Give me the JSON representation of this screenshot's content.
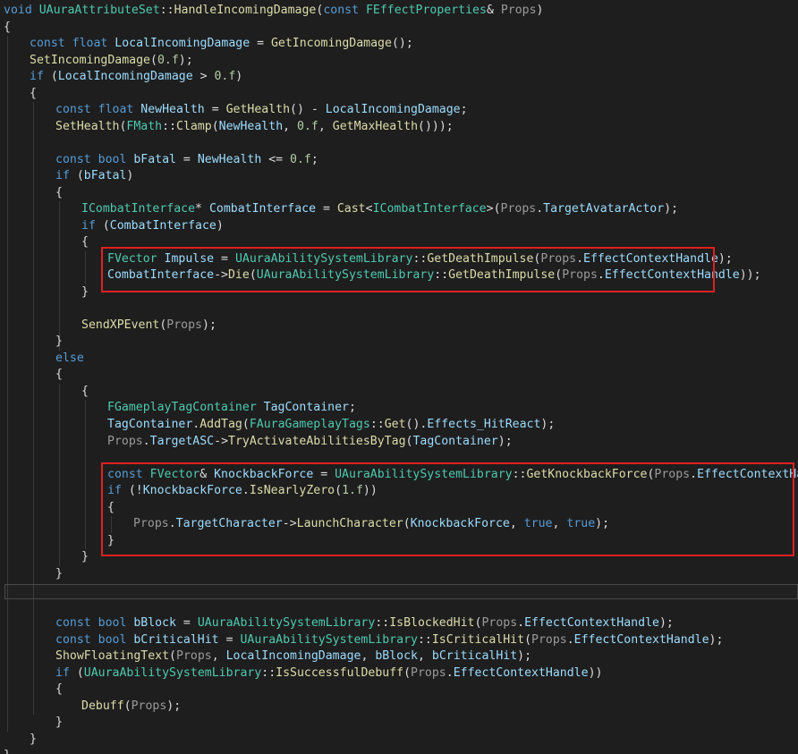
{
  "palette": {
    "background": "#1e1e1e",
    "keyword": "#569cd6",
    "type": "#4ec9b0",
    "function": "#dcdcaa",
    "variable": "#9cdcfe",
    "parameter": "#9a9a9a",
    "number": "#b5cea8",
    "plain": "#dcdcdc",
    "highlight_box": "#e02020"
  },
  "lines": [
    [
      {
        "t": "void ",
        "c": "kw"
      },
      {
        "t": "UAuraAttributeSet",
        "c": "ty"
      },
      {
        "t": "::",
        "c": "pl"
      },
      {
        "t": "HandleIncomingDamage",
        "c": "fn"
      },
      {
        "t": "(",
        "c": "pl"
      },
      {
        "t": "const ",
        "c": "kw"
      },
      {
        "t": "FEffectProperties",
        "c": "ty"
      },
      {
        "t": "& ",
        "c": "pl"
      },
      {
        "t": "Props",
        "c": "par"
      },
      {
        "t": ")",
        "c": "pl"
      }
    ],
    [
      {
        "t": "{",
        "c": "pl"
      }
    ],
    [
      {
        "t": "const ",
        "c": "kw"
      },
      {
        "t": "float ",
        "c": "kw"
      },
      {
        "t": "LocalIncomingDamage",
        "c": "var"
      },
      {
        "t": " = ",
        "c": "pl"
      },
      {
        "t": "GetIncomingDamage",
        "c": "fn"
      },
      {
        "t": "();",
        "c": "pl"
      }
    ],
    [
      {
        "t": "SetIncomingDamage",
        "c": "fn"
      },
      {
        "t": "(",
        "c": "pl"
      },
      {
        "t": "0.f",
        "c": "num"
      },
      {
        "t": ");",
        "c": "pl"
      }
    ],
    [
      {
        "t": "if ",
        "c": "kw"
      },
      {
        "t": "(",
        "c": "pl"
      },
      {
        "t": "LocalIncomingDamage",
        "c": "var"
      },
      {
        "t": " > ",
        "c": "pl"
      },
      {
        "t": "0.f",
        "c": "num"
      },
      {
        "t": ")",
        "c": "pl"
      }
    ],
    [
      {
        "t": "{",
        "c": "pl"
      }
    ],
    [
      {
        "t": "const ",
        "c": "kw"
      },
      {
        "t": "float ",
        "c": "kw"
      },
      {
        "t": "NewHealth",
        "c": "var"
      },
      {
        "t": " = ",
        "c": "pl"
      },
      {
        "t": "GetHealth",
        "c": "fn"
      },
      {
        "t": "() - ",
        "c": "pl"
      },
      {
        "t": "LocalIncomingDamage",
        "c": "var"
      },
      {
        "t": ";",
        "c": "pl"
      }
    ],
    [
      {
        "t": "SetHealth",
        "c": "fn"
      },
      {
        "t": "(",
        "c": "pl"
      },
      {
        "t": "FMath",
        "c": "ty"
      },
      {
        "t": "::",
        "c": "pl"
      },
      {
        "t": "Clamp",
        "c": "fn"
      },
      {
        "t": "(",
        "c": "pl"
      },
      {
        "t": "NewHealth",
        "c": "var"
      },
      {
        "t": ", ",
        "c": "pl"
      },
      {
        "t": "0.f",
        "c": "num"
      },
      {
        "t": ", ",
        "c": "pl"
      },
      {
        "t": "GetMaxHealth",
        "c": "fn"
      },
      {
        "t": "()));",
        "c": "pl"
      }
    ],
    [],
    [
      {
        "t": "const ",
        "c": "kw"
      },
      {
        "t": "bool ",
        "c": "kw"
      },
      {
        "t": "bFatal",
        "c": "var"
      },
      {
        "t": " = ",
        "c": "pl"
      },
      {
        "t": "NewHealth",
        "c": "var"
      },
      {
        "t": " <= ",
        "c": "pl"
      },
      {
        "t": "0.f",
        "c": "num"
      },
      {
        "t": ";",
        "c": "pl"
      }
    ],
    [
      {
        "t": "if ",
        "c": "kw"
      },
      {
        "t": "(",
        "c": "pl"
      },
      {
        "t": "bFatal",
        "c": "var"
      },
      {
        "t": ")",
        "c": "pl"
      }
    ],
    [
      {
        "t": "{",
        "c": "pl"
      }
    ],
    [
      {
        "t": "ICombatInterface",
        "c": "ty"
      },
      {
        "t": "* ",
        "c": "pl"
      },
      {
        "t": "CombatInterface",
        "c": "var"
      },
      {
        "t": " = ",
        "c": "pl"
      },
      {
        "t": "Cast",
        "c": "fn"
      },
      {
        "t": "<",
        "c": "pl"
      },
      {
        "t": "ICombatInterface",
        "c": "ty"
      },
      {
        "t": ">(",
        "c": "pl"
      },
      {
        "t": "Props",
        "c": "par"
      },
      {
        "t": ".",
        "c": "pl"
      },
      {
        "t": "TargetAvatarActor",
        "c": "var"
      },
      {
        "t": ");",
        "c": "pl"
      }
    ],
    [
      {
        "t": "if ",
        "c": "kw"
      },
      {
        "t": "(",
        "c": "pl"
      },
      {
        "t": "CombatInterface",
        "c": "var"
      },
      {
        "t": ")",
        "c": "pl"
      }
    ],
    [
      {
        "t": "{",
        "c": "pl"
      }
    ],
    [
      {
        "t": "FVector ",
        "c": "ty"
      },
      {
        "t": "Impulse",
        "c": "var"
      },
      {
        "t": " = ",
        "c": "pl"
      },
      {
        "t": "UAuraAbilitySystemLibrary",
        "c": "ty"
      },
      {
        "t": "::",
        "c": "pl"
      },
      {
        "t": "GetDeathImpulse",
        "c": "fn"
      },
      {
        "t": "(",
        "c": "pl"
      },
      {
        "t": "Props",
        "c": "par"
      },
      {
        "t": ".",
        "c": "pl"
      },
      {
        "t": "EffectContextHandle",
        "c": "var"
      },
      {
        "t": ");",
        "c": "pl"
      }
    ],
    [
      {
        "t": "CombatInterface",
        "c": "var"
      },
      {
        "t": "->",
        "c": "pl"
      },
      {
        "t": "Die",
        "c": "fn"
      },
      {
        "t": "(",
        "c": "pl"
      },
      {
        "t": "UAuraAbilitySystemLibrary",
        "c": "ty"
      },
      {
        "t": "::",
        "c": "pl"
      },
      {
        "t": "GetDeathImpulse",
        "c": "fn"
      },
      {
        "t": "(",
        "c": "pl"
      },
      {
        "t": "Props",
        "c": "par"
      },
      {
        "t": ".",
        "c": "pl"
      },
      {
        "t": "EffectContextHandle",
        "c": "var"
      },
      {
        "t": "));",
        "c": "pl"
      }
    ],
    [
      {
        "t": "}",
        "c": "pl"
      }
    ],
    [],
    [
      {
        "t": "SendXPEvent",
        "c": "fn"
      },
      {
        "t": "(",
        "c": "pl"
      },
      {
        "t": "Props",
        "c": "par"
      },
      {
        "t": ");",
        "c": "pl"
      }
    ],
    [
      {
        "t": "}",
        "c": "pl"
      }
    ],
    [
      {
        "t": "else",
        "c": "kw"
      }
    ],
    [
      {
        "t": "{",
        "c": "pl"
      }
    ],
    [
      {
        "t": "{",
        "c": "pl"
      }
    ],
    [
      {
        "t": "FGameplayTagContainer ",
        "c": "ty"
      },
      {
        "t": "TagContainer",
        "c": "var"
      },
      {
        "t": ";",
        "c": "pl"
      }
    ],
    [
      {
        "t": "TagContainer",
        "c": "var"
      },
      {
        "t": ".",
        "c": "pl"
      },
      {
        "t": "AddTag",
        "c": "fn"
      },
      {
        "t": "(",
        "c": "pl"
      },
      {
        "t": "FAuraGameplayTags",
        "c": "ty"
      },
      {
        "t": "::",
        "c": "pl"
      },
      {
        "t": "Get",
        "c": "fn"
      },
      {
        "t": "().",
        "c": "pl"
      },
      {
        "t": "Effects_HitReact",
        "c": "var"
      },
      {
        "t": ");",
        "c": "pl"
      }
    ],
    [
      {
        "t": "Props",
        "c": "par"
      },
      {
        "t": ".",
        "c": "pl"
      },
      {
        "t": "TargetASC",
        "c": "var"
      },
      {
        "t": "->",
        "c": "pl"
      },
      {
        "t": "TryActivateAbilitiesByTag",
        "c": "fn"
      },
      {
        "t": "(",
        "c": "pl"
      },
      {
        "t": "TagContainer",
        "c": "var"
      },
      {
        "t": ");",
        "c": "pl"
      }
    ],
    [],
    [
      {
        "t": "const ",
        "c": "kw"
      },
      {
        "t": "FVector",
        "c": "ty"
      },
      {
        "t": "& ",
        "c": "pl"
      },
      {
        "t": "KnockbackForce",
        "c": "var"
      },
      {
        "t": " = ",
        "c": "pl"
      },
      {
        "t": "UAuraAbilitySystemLibrary",
        "c": "ty"
      },
      {
        "t": "::",
        "c": "pl"
      },
      {
        "t": "GetKnockbackForce",
        "c": "fn"
      },
      {
        "t": "(",
        "c": "pl"
      },
      {
        "t": "Props",
        "c": "par"
      },
      {
        "t": ".",
        "c": "pl"
      },
      {
        "t": "EffectContextHandle",
        "c": "var"
      },
      {
        "t": ");",
        "c": "pl"
      }
    ],
    [
      {
        "t": "if ",
        "c": "kw"
      },
      {
        "t": "(!",
        "c": "pl"
      },
      {
        "t": "KnockbackForce",
        "c": "var"
      },
      {
        "t": ".",
        "c": "pl"
      },
      {
        "t": "IsNearlyZero",
        "c": "fn"
      },
      {
        "t": "(",
        "c": "pl"
      },
      {
        "t": "1.f",
        "c": "num"
      },
      {
        "t": "))",
        "c": "pl"
      }
    ],
    [
      {
        "t": "{",
        "c": "pl"
      }
    ],
    [
      {
        "t": "Props",
        "c": "par"
      },
      {
        "t": ".",
        "c": "pl"
      },
      {
        "t": "TargetCharacter",
        "c": "var"
      },
      {
        "t": "->",
        "c": "pl"
      },
      {
        "t": "LaunchCharacter",
        "c": "fn"
      },
      {
        "t": "(",
        "c": "pl"
      },
      {
        "t": "KnockbackForce",
        "c": "var"
      },
      {
        "t": ", ",
        "c": "pl"
      },
      {
        "t": "true",
        "c": "kw"
      },
      {
        "t": ", ",
        "c": "pl"
      },
      {
        "t": "true",
        "c": "kw"
      },
      {
        "t": ");",
        "c": "pl"
      }
    ],
    [
      {
        "t": "}",
        "c": "pl"
      }
    ],
    [
      {
        "t": "}",
        "c": "pl"
      }
    ],
    [
      {
        "t": "}",
        "c": "pl"
      }
    ],
    [],
    [],
    [
      {
        "t": "const ",
        "c": "kw"
      },
      {
        "t": "bool ",
        "c": "kw"
      },
      {
        "t": "bBlock",
        "c": "var"
      },
      {
        "t": " = ",
        "c": "pl"
      },
      {
        "t": "UAuraAbilitySystemLibrary",
        "c": "ty"
      },
      {
        "t": "::",
        "c": "pl"
      },
      {
        "t": "IsBlockedHit",
        "c": "fn"
      },
      {
        "t": "(",
        "c": "pl"
      },
      {
        "t": "Props",
        "c": "par"
      },
      {
        "t": ".",
        "c": "pl"
      },
      {
        "t": "EffectContextHandle",
        "c": "var"
      },
      {
        "t": ");",
        "c": "pl"
      }
    ],
    [
      {
        "t": "const ",
        "c": "kw"
      },
      {
        "t": "bool ",
        "c": "kw"
      },
      {
        "t": "bCriticalHit",
        "c": "var"
      },
      {
        "t": " = ",
        "c": "pl"
      },
      {
        "t": "UAuraAbilitySystemLibrary",
        "c": "ty"
      },
      {
        "t": "::",
        "c": "pl"
      },
      {
        "t": "IsCriticalHit",
        "c": "fn"
      },
      {
        "t": "(",
        "c": "pl"
      },
      {
        "t": "Props",
        "c": "par"
      },
      {
        "t": ".",
        "c": "pl"
      },
      {
        "t": "EffectContextHandle",
        "c": "var"
      },
      {
        "t": ");",
        "c": "pl"
      }
    ],
    [
      {
        "t": "ShowFloatingText",
        "c": "fn"
      },
      {
        "t": "(",
        "c": "pl"
      },
      {
        "t": "Props",
        "c": "par"
      },
      {
        "t": ", ",
        "c": "pl"
      },
      {
        "t": "LocalIncomingDamage",
        "c": "var"
      },
      {
        "t": ", ",
        "c": "pl"
      },
      {
        "t": "bBlock",
        "c": "var"
      },
      {
        "t": ", ",
        "c": "pl"
      },
      {
        "t": "bCriticalHit",
        "c": "var"
      },
      {
        "t": ");",
        "c": "pl"
      }
    ],
    [
      {
        "t": "if ",
        "c": "kw"
      },
      {
        "t": "(",
        "c": "pl"
      },
      {
        "t": "UAuraAbilitySystemLibrary",
        "c": "ty"
      },
      {
        "t": "::",
        "c": "pl"
      },
      {
        "t": "IsSuccessfulDebuff",
        "c": "fn"
      },
      {
        "t": "(",
        "c": "pl"
      },
      {
        "t": "Props",
        "c": "par"
      },
      {
        "t": ".",
        "c": "pl"
      },
      {
        "t": "EffectContextHandle",
        "c": "var"
      },
      {
        "t": "))",
        "c": "pl"
      }
    ],
    [
      {
        "t": "{",
        "c": "pl"
      }
    ],
    [
      {
        "t": "Debuff",
        "c": "fn"
      },
      {
        "t": "(",
        "c": "pl"
      },
      {
        "t": "Props",
        "c": "par"
      },
      {
        "t": ");",
        "c": "pl"
      }
    ],
    [
      {
        "t": "}",
        "c": "pl"
      }
    ],
    [
      {
        "t": "}",
        "c": "pl"
      }
    ],
    [
      {
        "t": "}",
        "c": "pl"
      }
    ]
  ]
}
